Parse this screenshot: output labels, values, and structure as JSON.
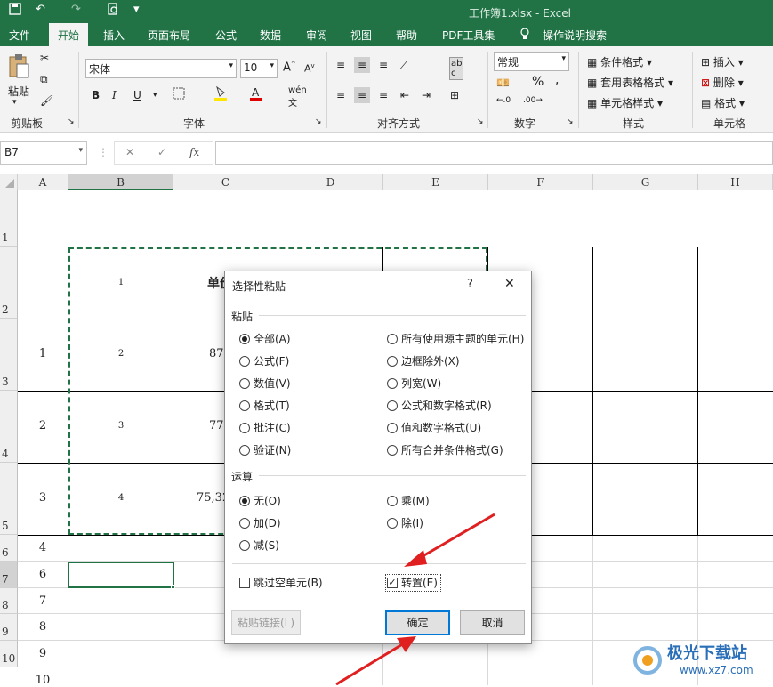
{
  "titlebar": {
    "title": "工作簿1.xlsx  -  Excel"
  },
  "menu": [
    "文件",
    "开始",
    "插入",
    "页面布局",
    "公式",
    "数据",
    "审阅",
    "视图",
    "帮助",
    "PDF工具集",
    "操作说明搜索"
  ],
  "ribbon": {
    "clipboard_label": "剪贴板",
    "paste_label": "粘贴",
    "font_label": "字体",
    "font_name": "宋体",
    "font_size": "10",
    "align_label": "对齐方式",
    "number_label": "数字",
    "number_format": "常规",
    "styles_label": "样式",
    "cond_format": "条件格式",
    "table_format": "套用表格格式",
    "cell_style": "单元格样式",
    "cells_label": "单元格",
    "insert": "插入",
    "delete": "删除",
    "format": "格式"
  },
  "formula": {
    "namebox": "B7",
    "fx": "fx",
    "cancel": "✕",
    "confirm": "✓"
  },
  "columns": [
    "A",
    "B",
    "C",
    "D",
    "E",
    "F",
    "G",
    "H"
  ],
  "rows": [
    "1",
    "2",
    "3",
    "4",
    "5",
    "6",
    "7",
    "8",
    "9",
    "10"
  ],
  "cells": {
    "b2": "1",
    "c2": "单价",
    "a3": "1",
    "b3": "2",
    "c3": "87",
    "a4": "2",
    "b4": "3",
    "c4": "77",
    "a5": "3",
    "b5": "4",
    "c5": "75,32",
    "a6": "4",
    "a7": "6",
    "a8": "7",
    "a9": "8",
    "a10": "9",
    "a11": "10"
  },
  "dialog": {
    "title": "选择性粘贴",
    "help": "?",
    "close": "✕",
    "paste_section": "粘贴",
    "paste_left": [
      "全部(A)",
      "公式(F)",
      "数值(V)",
      "格式(T)",
      "批注(C)",
      "验证(N)"
    ],
    "paste_right": [
      "所有使用源主题的单元(H)",
      "边框除外(X)",
      "列宽(W)",
      "公式和数字格式(R)",
      "值和数字格式(U)",
      "所有合并条件格式(G)"
    ],
    "op_section": "运算",
    "op_left": [
      "无(O)",
      "加(D)",
      "减(S)"
    ],
    "op_right": [
      "乘(M)",
      "除(I)"
    ],
    "skip_blanks": "跳过空单元(B)",
    "transpose": "转置(E)",
    "paste_link": "粘贴链接(L)",
    "ok": "确定",
    "cancel": "取消"
  },
  "watermark": {
    "text": "极光下载站",
    "url": "www.xz7.com"
  },
  "colors": {
    "excel_green": "#217346",
    "arrow_red": "#e02020"
  }
}
